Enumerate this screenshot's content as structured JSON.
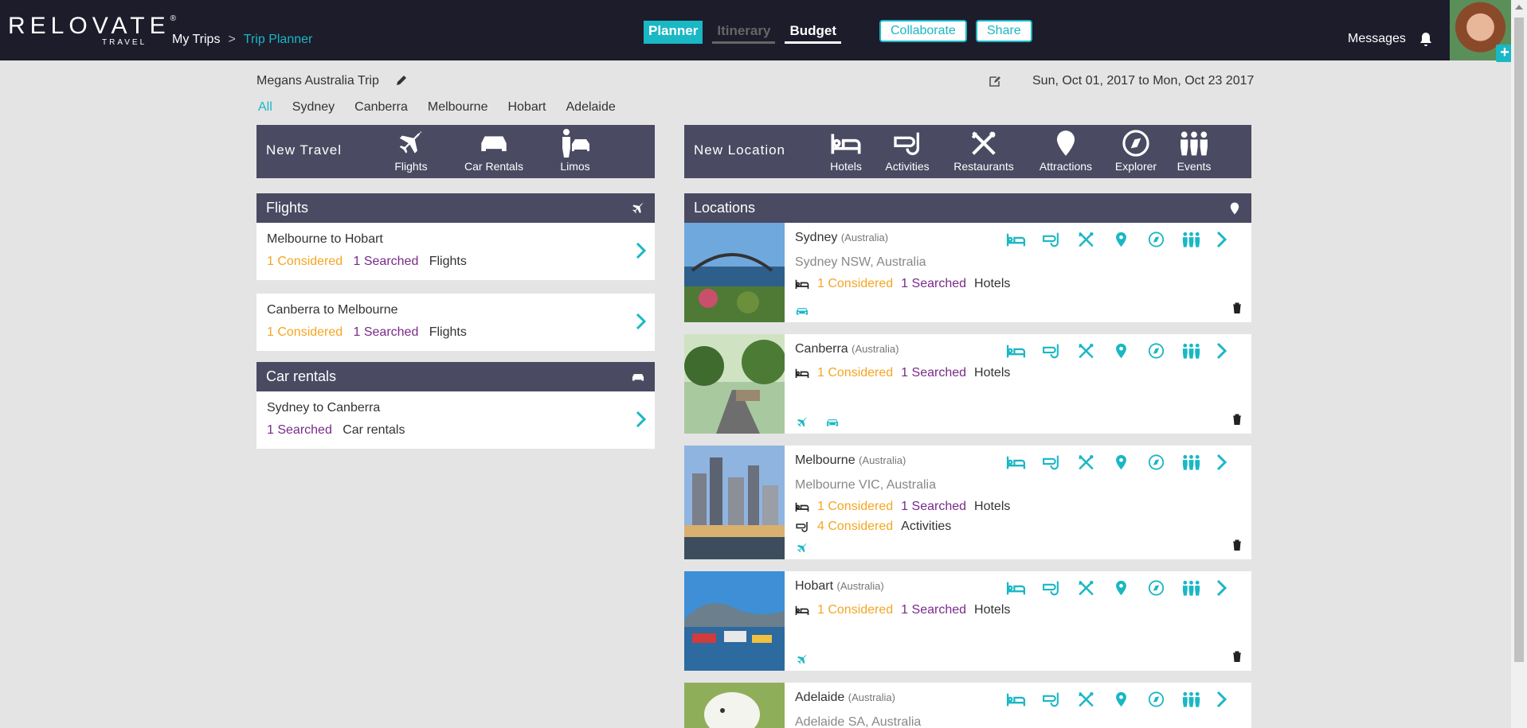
{
  "brand": {
    "word": "RELOVATE",
    "reg": "®",
    "sub": "TRAVEL"
  },
  "breadcrumb": {
    "home": "My Trips",
    "sep": ">",
    "current": "Trip Planner"
  },
  "modes": {
    "planner": "Planner",
    "itinerary": "Itinerary",
    "budget": "Budget"
  },
  "actions": {
    "collaborate": "Collaborate",
    "share": "Share"
  },
  "header": {
    "messages": "Messages",
    "avatar_plus": "+"
  },
  "trip": {
    "name": "Megans Australia Trip",
    "dates": "Sun, Oct 01, 2017 to Mon, Oct 23 2017"
  },
  "city_tabs": [
    "All",
    "Sydney",
    "Canberra",
    "Melbourne",
    "Hobart",
    "Adelaide"
  ],
  "new_travel": {
    "title": "New Travel",
    "items": [
      "Flights",
      "Car Rentals",
      "Limos"
    ]
  },
  "new_location": {
    "title": "New Location",
    "items": [
      "Hotels",
      "Activities",
      "Restaurants",
      "Attractions",
      "Explorer",
      "Events"
    ]
  },
  "flights": {
    "title": "Flights",
    "items": [
      {
        "route": "Melbourne to Hobart",
        "considered": "1 Considered",
        "searched": "1 Searched",
        "label": "Flights"
      },
      {
        "route": "Canberra to Melbourne",
        "considered": "1 Considered",
        "searched": "1 Searched",
        "label": "Flights"
      }
    ]
  },
  "car_rentals": {
    "title": "Car rentals",
    "items": [
      {
        "route": "Sydney to Canberra",
        "searched": "1 Searched",
        "label": "Car rentals"
      }
    ]
  },
  "locations": {
    "title": "Locations",
    "items": [
      {
        "name": "Sydney",
        "country": "(Australia)",
        "address": "Sydney NSW, Australia",
        "hotels_considered": "1 Considered",
        "hotels_searched": "1 Searched",
        "hotels_label": "Hotels"
      },
      {
        "name": "Canberra",
        "country": "(Australia)",
        "hotels_considered": "1 Considered",
        "hotels_searched": "1 Searched",
        "hotels_label": "Hotels"
      },
      {
        "name": "Melbourne",
        "country": "(Australia)",
        "address": "Melbourne VIC, Australia",
        "hotels_considered": "1 Considered",
        "hotels_searched": "1 Searched",
        "hotels_label": "Hotels",
        "activities_considered": "4 Considered",
        "activities_label": "Activities"
      },
      {
        "name": "Hobart",
        "country": "(Australia)",
        "hotels_considered": "1 Considered",
        "hotels_searched": "1 Searched",
        "hotels_label": "Hotels"
      },
      {
        "name": "Adelaide",
        "country": "(Australia)",
        "address": "Adelaide SA, Australia"
      }
    ]
  },
  "colors": {
    "accent": "#1ab7c5",
    "considered": "#f4a623",
    "searched": "#7a2a8a",
    "bar": "#4a4a62",
    "topbar": "#1c1c2b"
  }
}
